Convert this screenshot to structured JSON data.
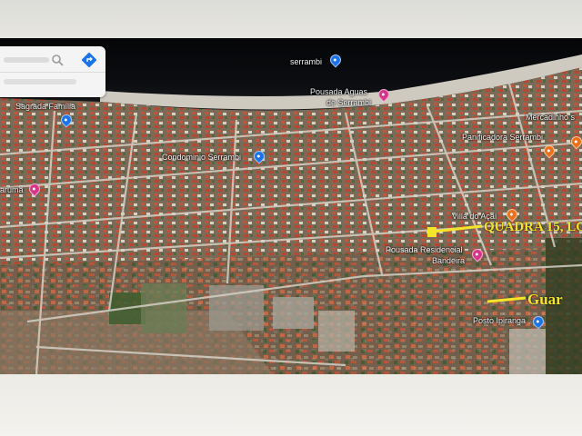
{
  "map": {
    "labels": [
      {
        "text": "serrambi",
        "id": "serrambi"
      },
      {
        "text": "Pousada Aguas",
        "id": "pousada-aguas-1"
      },
      {
        "text": "de Serrambi",
        "id": "pousada-aguas-2"
      },
      {
        "text": "Sagrada Família",
        "id": "sagrada-familia"
      },
      {
        "text": "Condominio Serrambi",
        "id": "condominio"
      },
      {
        "text": "Mercadinho s",
        "id": "mercadinho"
      },
      {
        "text": "Panificadora Serrambi",
        "id": "panificadora"
      },
      {
        "text": "Villa do Açaí",
        "id": "villa"
      },
      {
        "text": "Pousada Residencial",
        "id": "pousada-res-1"
      },
      {
        "text": "Bandeira",
        "id": "pousada-res-2"
      },
      {
        "text": "Posto Ipiranga",
        "id": "posto"
      },
      {
        "text": "aruma",
        "id": "aruma"
      }
    ],
    "annotations": [
      {
        "text": "QUADRA 15, LO",
        "id": "quadra"
      },
      {
        "text": "Guar",
        "id": "guar"
      }
    ]
  },
  "colors": {
    "blue_pin": "#1a73e8",
    "pink_pin": "#d6338a",
    "orange_pin": "#e8711a",
    "annotation": "#f5e52a"
  }
}
